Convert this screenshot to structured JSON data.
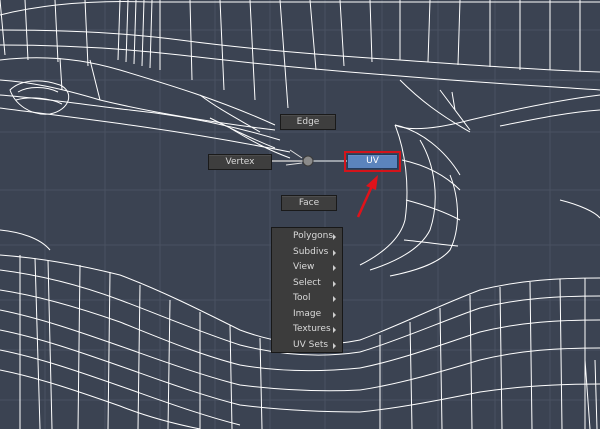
{
  "marking_menu": {
    "north": "Edge",
    "west": "Vertex",
    "east": "UV",
    "south": "Face"
  },
  "submenu": {
    "items": [
      {
        "label": "Polygons"
      },
      {
        "label": "Subdivs"
      },
      {
        "label": "View"
      },
      {
        "label": "Select"
      },
      {
        "label": "Tool"
      },
      {
        "label": "Image"
      },
      {
        "label": "Textures"
      },
      {
        "label": "UV Sets"
      }
    ]
  },
  "colors": {
    "viewport_bg": "#3b4352",
    "wireframe": "#ffffff",
    "grid": "#56606e",
    "highlight_box": "#d3141b",
    "uv_button": "#5b84bd",
    "arrow": "#e0121a"
  }
}
